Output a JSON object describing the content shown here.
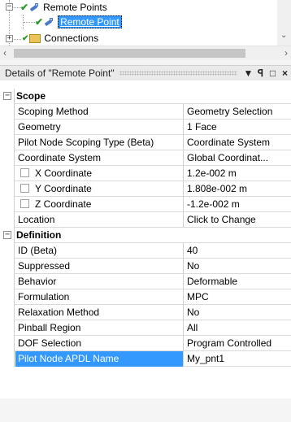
{
  "tree": {
    "nodes": [
      {
        "label": "Remote Points",
        "expander": "−"
      },
      {
        "label": "Remote Point",
        "selected": true
      },
      {
        "label": "Connections",
        "expander": "+"
      }
    ]
  },
  "details": {
    "title": "Details of \"Remote Point\"",
    "buttons": {
      "menu": "▼",
      "pin": "ꟼ",
      "maximize": "□",
      "close": "×"
    }
  },
  "grid": {
    "scope": {
      "label": "Scope",
      "rows": [
        {
          "name": "Scoping Method",
          "value": "Geometry Selection"
        },
        {
          "name": "Geometry",
          "value": "1 Face"
        },
        {
          "name": "Pilot Node Scoping Type (Beta)",
          "value": "Coordinate System"
        },
        {
          "name": "Coordinate System",
          "value": "Global Coordinat..."
        },
        {
          "name": "X Coordinate",
          "value": "1.2e-002 m",
          "checkbox": true
        },
        {
          "name": "Y Coordinate",
          "value": "1.808e-002 m",
          "checkbox": true
        },
        {
          "name": "Z Coordinate",
          "value": "-1.2e-002 m",
          "checkbox": true
        },
        {
          "name": "Location",
          "value": "Click to Change"
        }
      ]
    },
    "definition": {
      "label": "Definition",
      "rows": [
        {
          "name": "ID (Beta)",
          "value": "40"
        },
        {
          "name": "Suppressed",
          "value": "No"
        },
        {
          "name": "Behavior",
          "value": "Deformable"
        },
        {
          "name": "Formulation",
          "value": "MPC"
        },
        {
          "name": "Relaxation Method",
          "value": "No"
        },
        {
          "name": "Pinball Region",
          "value": "All"
        },
        {
          "name": "DOF Selection",
          "value": "Program Controlled"
        },
        {
          "name": "Pilot Node APDL Name",
          "value": "My_pnt1",
          "selected": true
        }
      ]
    }
  },
  "colors": {
    "selection": "#3399ff",
    "check": "#2a9a2a"
  }
}
